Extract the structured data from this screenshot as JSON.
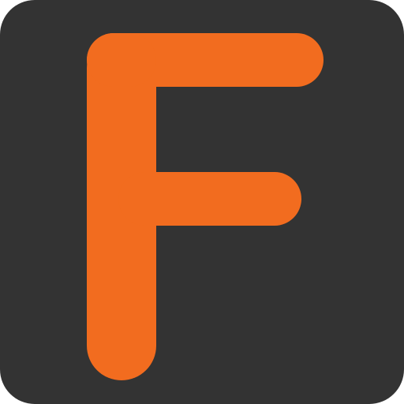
{
  "icon": {
    "letter": "F",
    "semantic": "letter-f-logo",
    "colors": {
      "background": "#333333",
      "glyph": "#F26C1F"
    }
  }
}
